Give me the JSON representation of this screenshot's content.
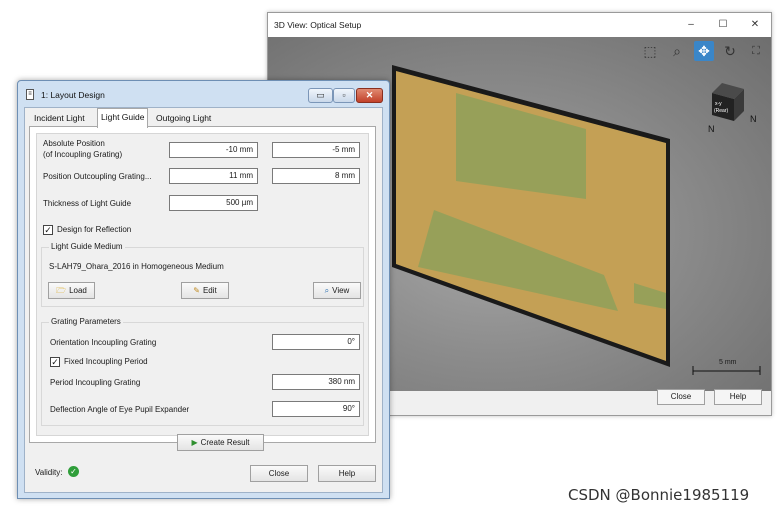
{
  "view3d": {
    "title": "3D View: Optical Setup",
    "minimize": "–",
    "maximize": "☐",
    "close": "✕",
    "icons": [
      "zoom-box-icon",
      "zoom-icon",
      "pan-icon",
      "rotate-icon",
      "fit-view-icon"
    ],
    "nav_cube_face": "x-y\n(Rear)",
    "scale_bar": "5 mm",
    "close_button": "Close",
    "help_button": "Help"
  },
  "dialog": {
    "title": "1: Layout Design",
    "tabs": [
      "Incident Light",
      "Light Guide",
      "Outgoing Light"
    ],
    "selected_tab": "Light Guide",
    "absolute_position_label": "Absolute Position",
    "absolute_position_sublabel": "(of Incoupling Grating)",
    "absolute_position_x": "-10 mm",
    "absolute_position_y": "-5 mm",
    "position_outcoupling_label": "Position Outcoupling Grating...",
    "position_outcoupling_x": "11 mm",
    "position_outcoupling_y": "8 mm",
    "thickness_label": "Thickness of Light Guide",
    "thickness_value": "500 µm",
    "design_for_reflection_label": "Design for Reflection",
    "design_for_reflection_checked": true,
    "medium_group_label": "Light Guide Medium",
    "medium_value": "S-LAH79_Ohara_2016 in Homogeneous Medium",
    "load_button": "Load",
    "edit_button": "Edit",
    "view_button": "View",
    "grating_group_label": "Grating Parameters",
    "orientation_label": "Orientation Incoupling Grating",
    "orientation_value": "0°",
    "fixed_period_label": "Fixed Incoupling Period",
    "fixed_period_checked": true,
    "period_label": "Period Incoupling Grating",
    "period_value": "380 nm",
    "deflection_label": "Deflection Angle of Eye Pupil Expander",
    "deflection_value": "90°",
    "create_result_button": "Create Result",
    "validity_label": "Validity:",
    "close_button": "Close",
    "help_button": "Help"
  },
  "watermark": "CSDN @Bonnie1985119",
  "colors": {
    "plate": "#c4a055",
    "grating": "#8fa05a",
    "validity_ok": "#2f9e3a",
    "accent": "#3a86c8"
  }
}
